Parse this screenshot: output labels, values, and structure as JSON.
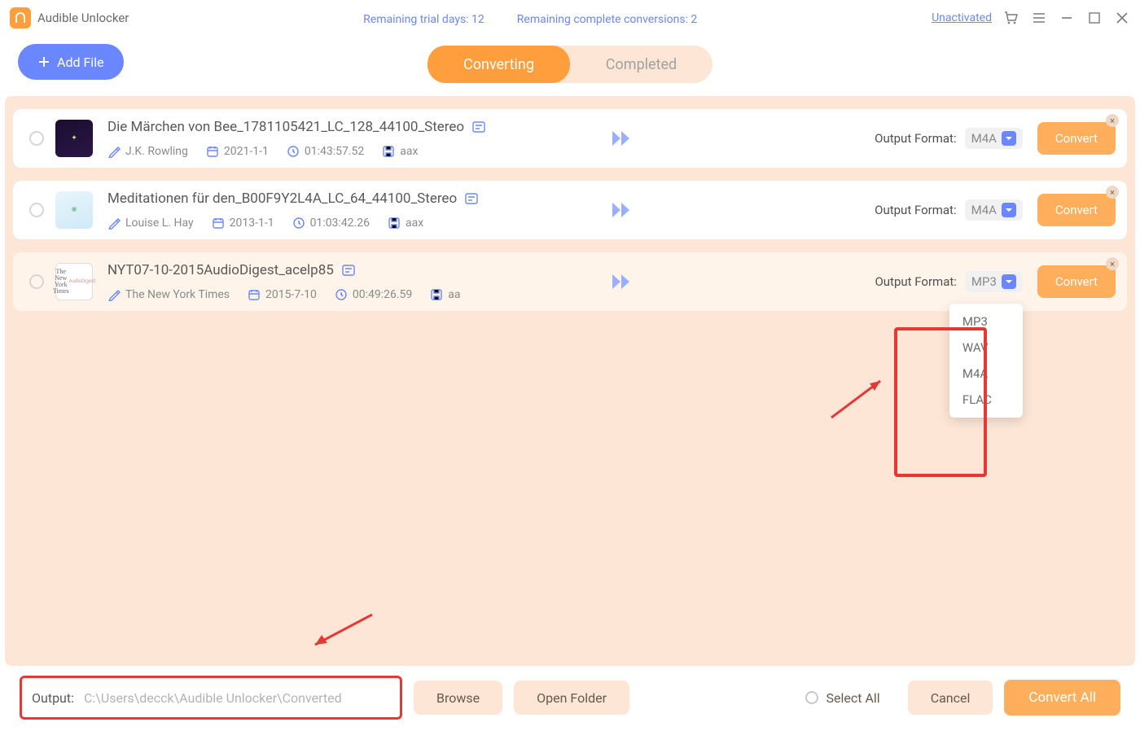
{
  "app": {
    "title": "Audible Unlocker",
    "trial_days_label": "Remaining trial days: 12",
    "conversions_label": "Remaining complete conversions: 2",
    "unactivated_label": "Unactivated"
  },
  "toolbar": {
    "add_file_label": "Add File"
  },
  "tabs": {
    "converting": "Converting",
    "completed": "Completed"
  },
  "common": {
    "output_format_label": "Output Format:",
    "convert_label": "Convert"
  },
  "items": [
    {
      "title": "Die Märchen von Bee_1781105421_LC_128_44100_Stereo",
      "author": "J.K. Rowling",
      "date": "2021-1-1",
      "duration": "01:43:57.52",
      "ext": "aax",
      "format": "M4A"
    },
    {
      "title": "Meditationen für den_B00F9Y2L4A_LC_64_44100_Stereo",
      "author": "Louise L. Hay",
      "date": "2013-1-1",
      "duration": "01:03:42.26",
      "ext": "aax",
      "format": "M4A"
    },
    {
      "title": "NYT07-10-2015AudioDigest_acelp85",
      "author": "The New York Times",
      "date": "2015-7-10",
      "duration": "00:49:26.59",
      "ext": "aa",
      "format": "MP3"
    }
  ],
  "dropdown": {
    "opt1": "MP3",
    "opt2": "WAV",
    "opt3": "M4A",
    "opt4": "FLAC"
  },
  "footer": {
    "output_label": "Output:",
    "output_path": "C:\\Users\\decck\\Audible Unlocker\\Converted",
    "browse_label": "Browse",
    "open_folder_label": "Open Folder",
    "select_all_label": "Select All",
    "cancel_label": "Cancel",
    "convert_all_label": "Convert All"
  }
}
